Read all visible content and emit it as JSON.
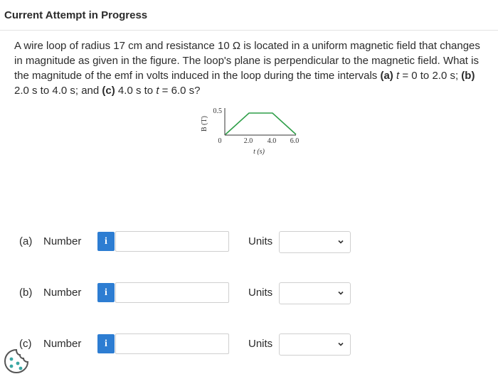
{
  "header": {
    "title": "Current Attempt in Progress"
  },
  "question": {
    "text_1": "A wire loop of radius 17 cm and resistance 10 Ω is located in a uniform magnetic field that changes in magnitude as given in the figure. The loop's plane is perpendicular to the magnetic field. What is the magnitude of the emf in volts induced in the loop during the time intervals ",
    "a_label": "(a)",
    "a_t": "t",
    "a_text": " = 0 to 2.0 s; ",
    "b_label": "(b)",
    "b_text": " 2.0 s to 4.0 s; and ",
    "c_label": "(c)",
    "c_text": " 4.0 s to ",
    "c_t": "t",
    "c_end": " = 6.0 s?"
  },
  "figure": {
    "ylabel": "B (T)",
    "xlabel": "t (s)",
    "y_tick": "0.5",
    "x_ticks": [
      "0",
      "2.0",
      "4.0",
      "6.0"
    ],
    "line_color": "#2e9e48",
    "data": {
      "t": [
        0,
        2.0,
        4.0,
        6.0
      ],
      "B": [
        0,
        0.5,
        0.5,
        0
      ]
    }
  },
  "parts": [
    {
      "label": "(a)",
      "number_label": "Number",
      "info": "i",
      "value": "",
      "units_label": "Units",
      "units_value": ""
    },
    {
      "label": "(b)",
      "number_label": "Number",
      "info": "i",
      "value": "",
      "units_label": "Units",
      "units_value": ""
    },
    {
      "label": "(c)",
      "number_label": "Number",
      "info": "i",
      "value": "",
      "units_label": "Units",
      "units_value": ""
    }
  ],
  "colors": {
    "info_button": "#2d7dd2",
    "border": "#cfcfcf"
  }
}
